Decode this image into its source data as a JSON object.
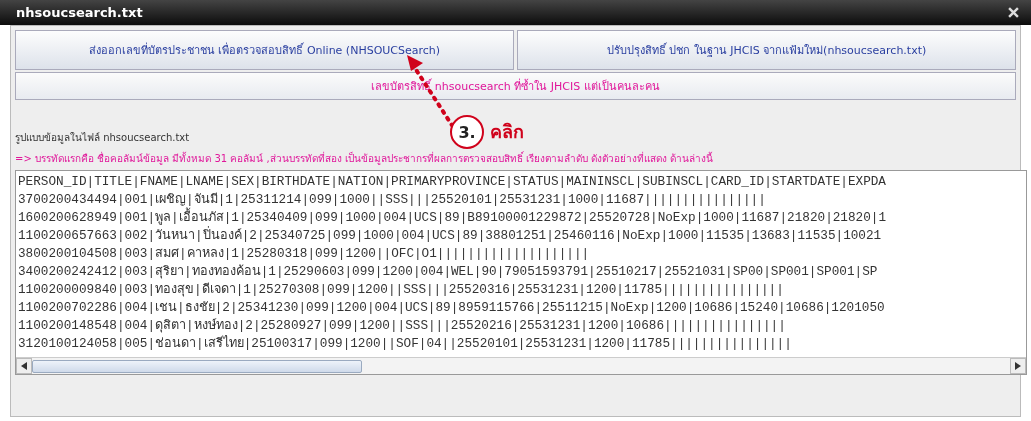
{
  "window": {
    "title": "nhsoucsearch.txt"
  },
  "buttons": [
    "ส่งออกเลขที่บัตรประชาชน เพื่อตรวจสอบสิทธิ์ Online (NHSOUCSearch)",
    "ปรับปรุงสิทธิ์ ปชก ในฐาน JHCIS จากแฟ้มใหม่(nhsoucsearch.txt)"
  ],
  "duplicate_button": "เลขบัตรสิทธิ์ nhsoucsearch ที่ซ้ำใน JHCIS แต่เป็นคนละคน",
  "annotation": {
    "step": "3.",
    "label": "คลิก"
  },
  "format_label": "รูปแบบข้อมูลในไฟล์ nhsoucsearch.txt",
  "format_note": "=> บรรทัดแรกคือ ชื่อคอลัมน์ข้อมูล มีทั้งหมด 31 คอลัมน์ ,ส่วนบรรทัดที่สอง เป็นข้อมูลประชากรที่ผลการตรวจสอบสิทธิ์ เรียงตามลำดับ ดังตัวอย่างที่แสดง ด้านล่างนี้",
  "file_lines": [
    "PERSON_ID|TITLE|FNAME|LNAME|SEX|BIRTHDATE|NATION|PRIMARYPROVINCE|STATUS|MAININSCL|SUBINSCL|CARD_ID|STARTDATE|EXPDA",
    "3700200434494|001|เผชิญ|จันมี|1|25311214|099|1000||SSS|||25520101|25531231|1000|11687||||||||||||||||",
    "1600200628949|001|พูล|เอื้อนภัส|1|25340409|099|1000|004|UCS|89|B89100001229872|25520728|NoExp|1000|11687|21820|21820|1",
    "1100200657663|002|วันหนา|ปิ่นองค์|2|25340725|099|1000|004|UCS|89|38801251|25460116|NoExp|1000|11535|13683|11535|10021",
    "3800200104508|003|สมศ|คาหลง|1|25280318|099|1200||OFC|O1||||||||||||||||||||",
    "3400200242412|003|สุริยา|ทองทองค้อน|1|25290603|099|1200|004|WEL|90|79051593791|25510217|25521031|SP00|SP001|SP001|SP",
    "1100200009840|003|ทองสุข|ดีเจดา|1|25270308|099|1200||SSS|||25520316|25531231|1200|11785||||||||||||||||",
    "1100200702286|004|เชน|ธงชัย|2|25341230|099|1200|004|UCS|89|8959115766|25511215|NoExp|1200|10686|15240|10686|1201050",
    "1100200148548|004|ดุสิตา|หงษ์ทอง|2|25280927|099|1200||SSS|||25520216|25531231|1200|10686||||||||||||||||",
    "3120100124058|005|ช่อนดา|เสรีไทย|25100317|099|1200||SOF|04||25520101|25531231|1200|11785||||||||||||||||"
  ]
}
